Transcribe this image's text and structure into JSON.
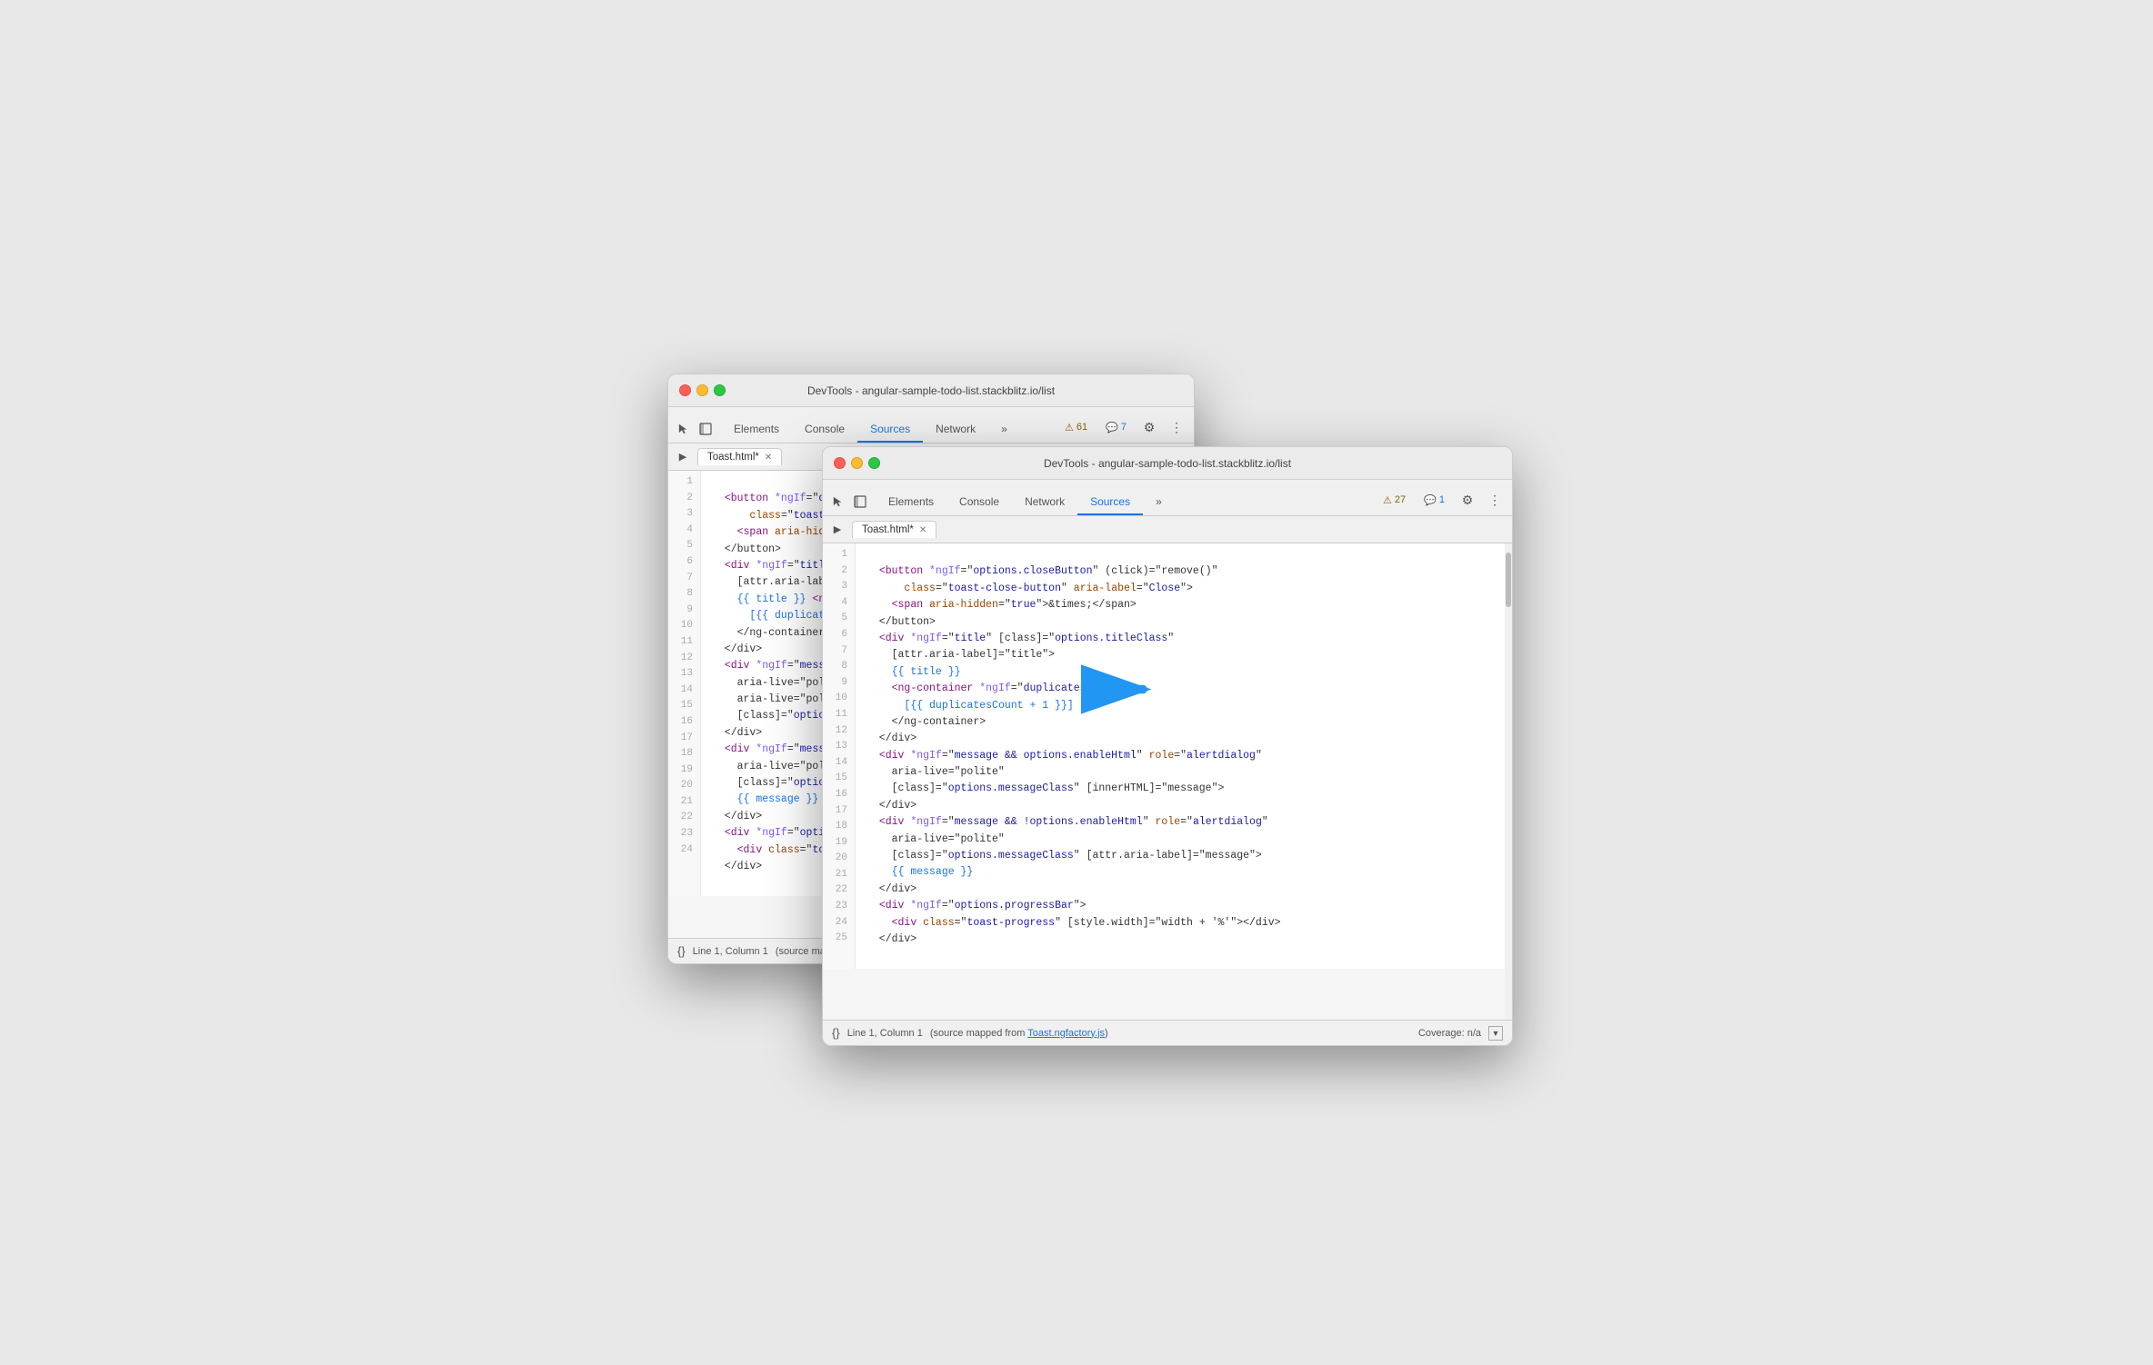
{
  "back_window": {
    "title": "DevTools - angular-sample-todo-list.stackblitz.io/list",
    "tabs": [
      "Elements",
      "Console",
      "Sources",
      "Network"
    ],
    "active_tab": "Sources",
    "file_tab": "Toast.html*",
    "badge_warning": "⚠ 61",
    "badge_info": "💬 7",
    "status": "Line 1, Column 1",
    "status_source": "(source mapped from",
    "lines": [
      "",
      "  <button *ngIf=\"options.closeButton\" (cli",
      "      class=\"toast-close-button\" aria-label=",
      "    <span aria-hidden=\"true\">&times;</span",
      "  </button>",
      "  <div *ngIf=\"title\" [class]=\"options.titl",
      "    [attr.aria-label]=\"title\">",
      "    {{ title }} <ng-container *ngIf=\"dupli",
      "      [{{ duplicatesCount + 1 }}]",
      "    </ng-container>",
      "  </div>",
      "  <div *ngIf=\"message && options.enabl",
      "    aria-live=\"polite\"",
      "    aria-live=\"polite\"",
      "    [class]=\"options.messageClass\" [in",
      "  </div>",
      "  <div *ngIf=\"message && !options.enableHt",
      "    aria-live=\"polite\"",
      "    [class]=\"options.messageClass\" [attr.a",
      "    {{ message }}",
      "  </div>",
      "  <div *ngIf=\"options.progressBar\">",
      "    <div class=\"toast-progress\" [style.wid",
      "  </div>",
      ""
    ]
  },
  "front_window": {
    "title": "DevTools - angular-sample-todo-list.stackblitz.io/list",
    "tabs": [
      "Elements",
      "Console",
      "Network",
      "Sources"
    ],
    "active_tab": "Sources",
    "file_tab": "Toast.html*",
    "badge_warning": "⚠ 27",
    "badge_info": "💬 1",
    "status": "Line 1, Column 1",
    "status_source": "(source mapped from Toast.ngfactory.js)",
    "status_coverage": "Coverage: n/a",
    "lines": [
      "",
      "  <button *ngIf=\"options.closeButton\" (click)=\"remove()\"",
      "      class=\"toast-close-button\" aria-label=\"Close\">",
      "    <span aria-hidden=\"true\">&times;</span>",
      "  </button>",
      "  <div *ngIf=\"title\" [class]=\"options.titleClass\"",
      "    [attr.aria-label]=\"title\">",
      "    {{ title }}",
      "    <ng-container *ngIf=\"duplicatesCount\">",
      "      [{{ duplicatesCount + 1 }}]",
      "    </ng-container>",
      "  </div>",
      "  <div *ngIf=\"message && options.enableHtml\" role=\"alertdialog\"",
      "    aria-live=\"polite\"",
      "    [class]=\"options.messageClass\" [innerHTML]=\"message\">",
      "  </div>",
      "  <div *ngIf=\"message && !options.enableHtml\" role=\"alertdialog\"",
      "    aria-live=\"polite\"",
      "    [class]=\"options.messageClass\" [attr.aria-label]=\"message\">",
      "    {{ message }}",
      "  </div>",
      "  <div *ngIf=\"options.progressBar\">",
      "    <div class=\"toast-progress\" [style.width]=\"width + '%'\"></div>",
      "  </div>",
      ""
    ]
  },
  "arrow": {
    "color": "#2196F3"
  }
}
